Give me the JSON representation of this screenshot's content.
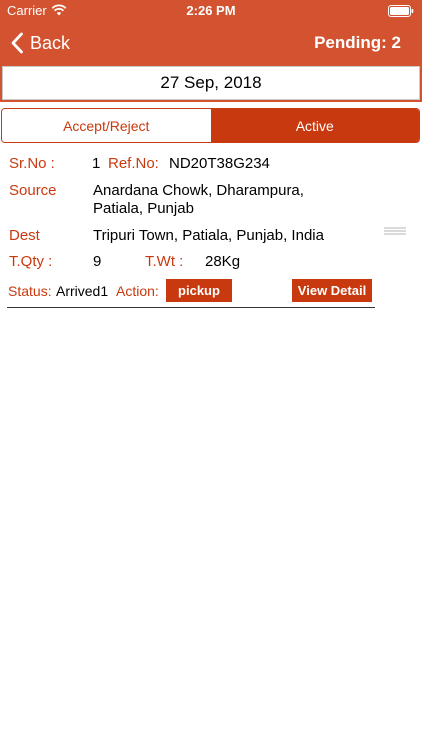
{
  "status_bar": {
    "carrier": "Carrier",
    "time": "2:26 PM"
  },
  "nav": {
    "back_label": "Back",
    "pending": "Pending: 2"
  },
  "date": "27 Sep, 2018",
  "segments": {
    "accept_reject": "Accept/Reject",
    "active": "Active",
    "selected": "Active"
  },
  "record": {
    "srno_label": "Sr.No :",
    "srno_value": "1",
    "refno_label": "Ref.No:",
    "refno_value": "ND20T38G234",
    "source_label": "Source",
    "source_line1": "Anardana Chowk, Dharampura,",
    "source_line2": "Patiala, Punjab",
    "dest_label": "Dest",
    "dest_value": "Tripuri Town, Patiala, Punjab, India",
    "tqty_label": "T.Qty :",
    "tqty_value": "9",
    "twt_label": "T.Wt :",
    "twt_value": "28Kg",
    "status_label": "Status:",
    "status_value": "Arrived1",
    "action_label": "Action:",
    "action_button": "pickup",
    "view_detail_button": "View Detail"
  },
  "colors": {
    "header_bg": "#d35230",
    "accent": "#c9390f",
    "text": "#000000",
    "white": "#ffffff"
  },
  "icons": {
    "wifi": "wifi-icon",
    "battery": "battery-icon",
    "back": "chevron-left-icon",
    "drag": "drag-handle-icon"
  }
}
